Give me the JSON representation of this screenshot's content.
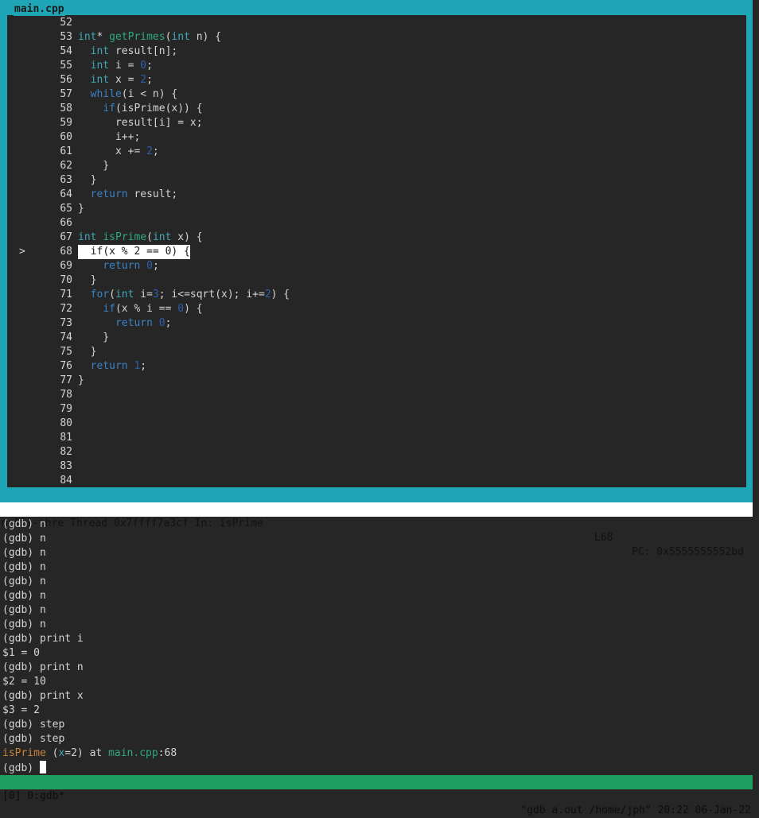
{
  "window": {
    "title": "main.cpp"
  },
  "source": {
    "lines": [
      {
        "num": "52",
        "marker": "",
        "highlight": false,
        "tokens": []
      },
      {
        "num": "53",
        "marker": "",
        "highlight": false,
        "tokens": [
          {
            "t": "int",
            "c": "ty"
          },
          {
            "t": "* ",
            "c": ""
          },
          {
            "t": "getPrimes",
            "c": "fn"
          },
          {
            "t": "(",
            "c": ""
          },
          {
            "t": "int",
            "c": "ty"
          },
          {
            "t": " n) {",
            "c": ""
          }
        ]
      },
      {
        "num": "54",
        "marker": "",
        "highlight": false,
        "tokens": [
          {
            "t": "  ",
            "c": ""
          },
          {
            "t": "int",
            "c": "ty"
          },
          {
            "t": " result[n];",
            "c": ""
          }
        ]
      },
      {
        "num": "55",
        "marker": "",
        "highlight": false,
        "tokens": [
          {
            "t": "  ",
            "c": ""
          },
          {
            "t": "int",
            "c": "ty"
          },
          {
            "t": " i = ",
            "c": ""
          },
          {
            "t": "0",
            "c": "num"
          },
          {
            "t": ";",
            "c": ""
          }
        ]
      },
      {
        "num": "56",
        "marker": "",
        "highlight": false,
        "tokens": [
          {
            "t": "  ",
            "c": ""
          },
          {
            "t": "int",
            "c": "ty"
          },
          {
            "t": " x = ",
            "c": ""
          },
          {
            "t": "2",
            "c": "num"
          },
          {
            "t": ";",
            "c": ""
          }
        ]
      },
      {
        "num": "57",
        "marker": "",
        "highlight": false,
        "tokens": [
          {
            "t": "  ",
            "c": ""
          },
          {
            "t": "while",
            "c": "kw"
          },
          {
            "t": "(i < n) {",
            "c": ""
          }
        ]
      },
      {
        "num": "58",
        "marker": "",
        "highlight": false,
        "tokens": [
          {
            "t": "    ",
            "c": ""
          },
          {
            "t": "if",
            "c": "kw"
          },
          {
            "t": "(isPrime(x)) {",
            "c": ""
          }
        ]
      },
      {
        "num": "59",
        "marker": "",
        "highlight": false,
        "tokens": [
          {
            "t": "      result[i] = x;",
            "c": ""
          }
        ]
      },
      {
        "num": "60",
        "marker": "",
        "highlight": false,
        "tokens": [
          {
            "t": "      i++;",
            "c": ""
          }
        ]
      },
      {
        "num": "61",
        "marker": "",
        "highlight": false,
        "tokens": [
          {
            "t": "      x += ",
            "c": ""
          },
          {
            "t": "2",
            "c": "num"
          },
          {
            "t": ";",
            "c": ""
          }
        ]
      },
      {
        "num": "62",
        "marker": "",
        "highlight": false,
        "tokens": [
          {
            "t": "    }",
            "c": ""
          }
        ]
      },
      {
        "num": "63",
        "marker": "",
        "highlight": false,
        "tokens": [
          {
            "t": "  }",
            "c": ""
          }
        ]
      },
      {
        "num": "64",
        "marker": "",
        "highlight": false,
        "tokens": [
          {
            "t": "  ",
            "c": ""
          },
          {
            "t": "return",
            "c": "kw"
          },
          {
            "t": " result;",
            "c": ""
          }
        ]
      },
      {
        "num": "65",
        "marker": "",
        "highlight": false,
        "tokens": [
          {
            "t": "}",
            "c": ""
          }
        ]
      },
      {
        "num": "66",
        "marker": "",
        "highlight": false,
        "tokens": []
      },
      {
        "num": "67",
        "marker": "",
        "highlight": false,
        "tokens": [
          {
            "t": "int",
            "c": "ty"
          },
          {
            "t": " ",
            "c": ""
          },
          {
            "t": "isPrime",
            "c": "fn"
          },
          {
            "t": "(",
            "c": ""
          },
          {
            "t": "int",
            "c": "ty"
          },
          {
            "t": " x) {",
            "c": ""
          }
        ]
      },
      {
        "num": "68",
        "marker": ">",
        "highlight": true,
        "tokens": [
          {
            "t": "  ",
            "c": ""
          },
          {
            "t": "if",
            "c": "kw"
          },
          {
            "t": "(x % 2 == 0) {",
            "c": ""
          }
        ]
      },
      {
        "num": "69",
        "marker": "",
        "highlight": false,
        "tokens": [
          {
            "t": "    ",
            "c": ""
          },
          {
            "t": "return",
            "c": "kw"
          },
          {
            "t": " ",
            "c": ""
          },
          {
            "t": "0",
            "c": "num"
          },
          {
            "t": ";",
            "c": ""
          }
        ]
      },
      {
        "num": "70",
        "marker": "",
        "highlight": false,
        "tokens": [
          {
            "t": "  }",
            "c": ""
          }
        ]
      },
      {
        "num": "71",
        "marker": "",
        "highlight": false,
        "tokens": [
          {
            "t": "  ",
            "c": ""
          },
          {
            "t": "for",
            "c": "kw"
          },
          {
            "t": "(",
            "c": ""
          },
          {
            "t": "int",
            "c": "ty"
          },
          {
            "t": " i=",
            "c": ""
          },
          {
            "t": "3",
            "c": "num"
          },
          {
            "t": "; i<=sqrt(x); i+=",
            "c": ""
          },
          {
            "t": "2",
            "c": "num"
          },
          {
            "t": ") {",
            "c": ""
          }
        ]
      },
      {
        "num": "72",
        "marker": "",
        "highlight": false,
        "tokens": [
          {
            "t": "    ",
            "c": ""
          },
          {
            "t": "if",
            "c": "kw"
          },
          {
            "t": "(x % i == ",
            "c": ""
          },
          {
            "t": "0",
            "c": "num"
          },
          {
            "t": ") {",
            "c": ""
          }
        ]
      },
      {
        "num": "73",
        "marker": "",
        "highlight": false,
        "tokens": [
          {
            "t": "      ",
            "c": ""
          },
          {
            "t": "return",
            "c": "kw"
          },
          {
            "t": " ",
            "c": ""
          },
          {
            "t": "0",
            "c": "num"
          },
          {
            "t": ";",
            "c": ""
          }
        ]
      },
      {
        "num": "74",
        "marker": "",
        "highlight": false,
        "tokens": [
          {
            "t": "    }",
            "c": ""
          }
        ]
      },
      {
        "num": "75",
        "marker": "",
        "highlight": false,
        "tokens": [
          {
            "t": "  }",
            "c": ""
          }
        ]
      },
      {
        "num": "76",
        "marker": "",
        "highlight": false,
        "tokens": [
          {
            "t": "  ",
            "c": ""
          },
          {
            "t": "return",
            "c": "kw"
          },
          {
            "t": " ",
            "c": ""
          },
          {
            "t": "1",
            "c": "num"
          },
          {
            "t": ";",
            "c": ""
          }
        ]
      },
      {
        "num": "77",
        "marker": "",
        "highlight": false,
        "tokens": [
          {
            "t": "}",
            "c": ""
          }
        ]
      },
      {
        "num": "78",
        "marker": "",
        "highlight": false,
        "tokens": []
      },
      {
        "num": "79",
        "marker": "",
        "highlight": false,
        "tokens": []
      },
      {
        "num": "80",
        "marker": "",
        "highlight": false,
        "tokens": []
      },
      {
        "num": "81",
        "marker": "",
        "highlight": false,
        "tokens": []
      },
      {
        "num": "82",
        "marker": "",
        "highlight": false,
        "tokens": []
      },
      {
        "num": "83",
        "marker": "",
        "highlight": false,
        "tokens": []
      },
      {
        "num": "84",
        "marker": "",
        "highlight": false,
        "tokens": []
      }
    ]
  },
  "status": {
    "left": "multi-thre Thread 0x7ffff7a3cf In: isPrime",
    "line": "L68",
    "pc": "PC: 0x5555555552bd"
  },
  "console": {
    "lines": [
      [
        {
          "t": "(gdb) n",
          "c": ""
        }
      ],
      [
        {
          "t": "(gdb) n",
          "c": ""
        }
      ],
      [
        {
          "t": "(gdb) n",
          "c": ""
        }
      ],
      [
        {
          "t": "(gdb) n",
          "c": ""
        }
      ],
      [
        {
          "t": "(gdb) n",
          "c": ""
        }
      ],
      [
        {
          "t": "(gdb) n",
          "c": ""
        }
      ],
      [
        {
          "t": "(gdb) n",
          "c": ""
        }
      ],
      [
        {
          "t": "(gdb) n",
          "c": ""
        }
      ],
      [
        {
          "t": "(gdb) print i",
          "c": ""
        }
      ],
      [
        {
          "t": "$1 = 0",
          "c": ""
        }
      ],
      [
        {
          "t": "(gdb) print n",
          "c": ""
        }
      ],
      [
        {
          "t": "$2 = 10",
          "c": ""
        }
      ],
      [
        {
          "t": "(gdb) print x",
          "c": ""
        }
      ],
      [
        {
          "t": "$3 = 2",
          "c": ""
        }
      ],
      [
        {
          "t": "(gdb) step",
          "c": ""
        }
      ],
      [
        {
          "t": "(gdb) step",
          "c": ""
        }
      ],
      [
        {
          "t": "isPrime",
          "c": "orange"
        },
        {
          "t": " (",
          "c": ""
        },
        {
          "t": "x",
          "c": "teal"
        },
        {
          "t": "=2) at ",
          "c": ""
        },
        {
          "t": "main.cpp",
          "c": "green"
        },
        {
          "t": ":68",
          "c": ""
        }
      ]
    ],
    "prompt": "(gdb) "
  },
  "tmux": {
    "window": "[0] 0:gdb*",
    "right": "\"gdb a.out /home/jph\" 20:22 06-Jan-22"
  },
  "colors": {
    "frame": "#1fa6b6",
    "background": "#262626",
    "tmux_bar": "#1e9e62",
    "keyword": "#3b82c4",
    "type": "#3fa8b8",
    "function": "#2fa880",
    "number": "#2e5fae"
  }
}
